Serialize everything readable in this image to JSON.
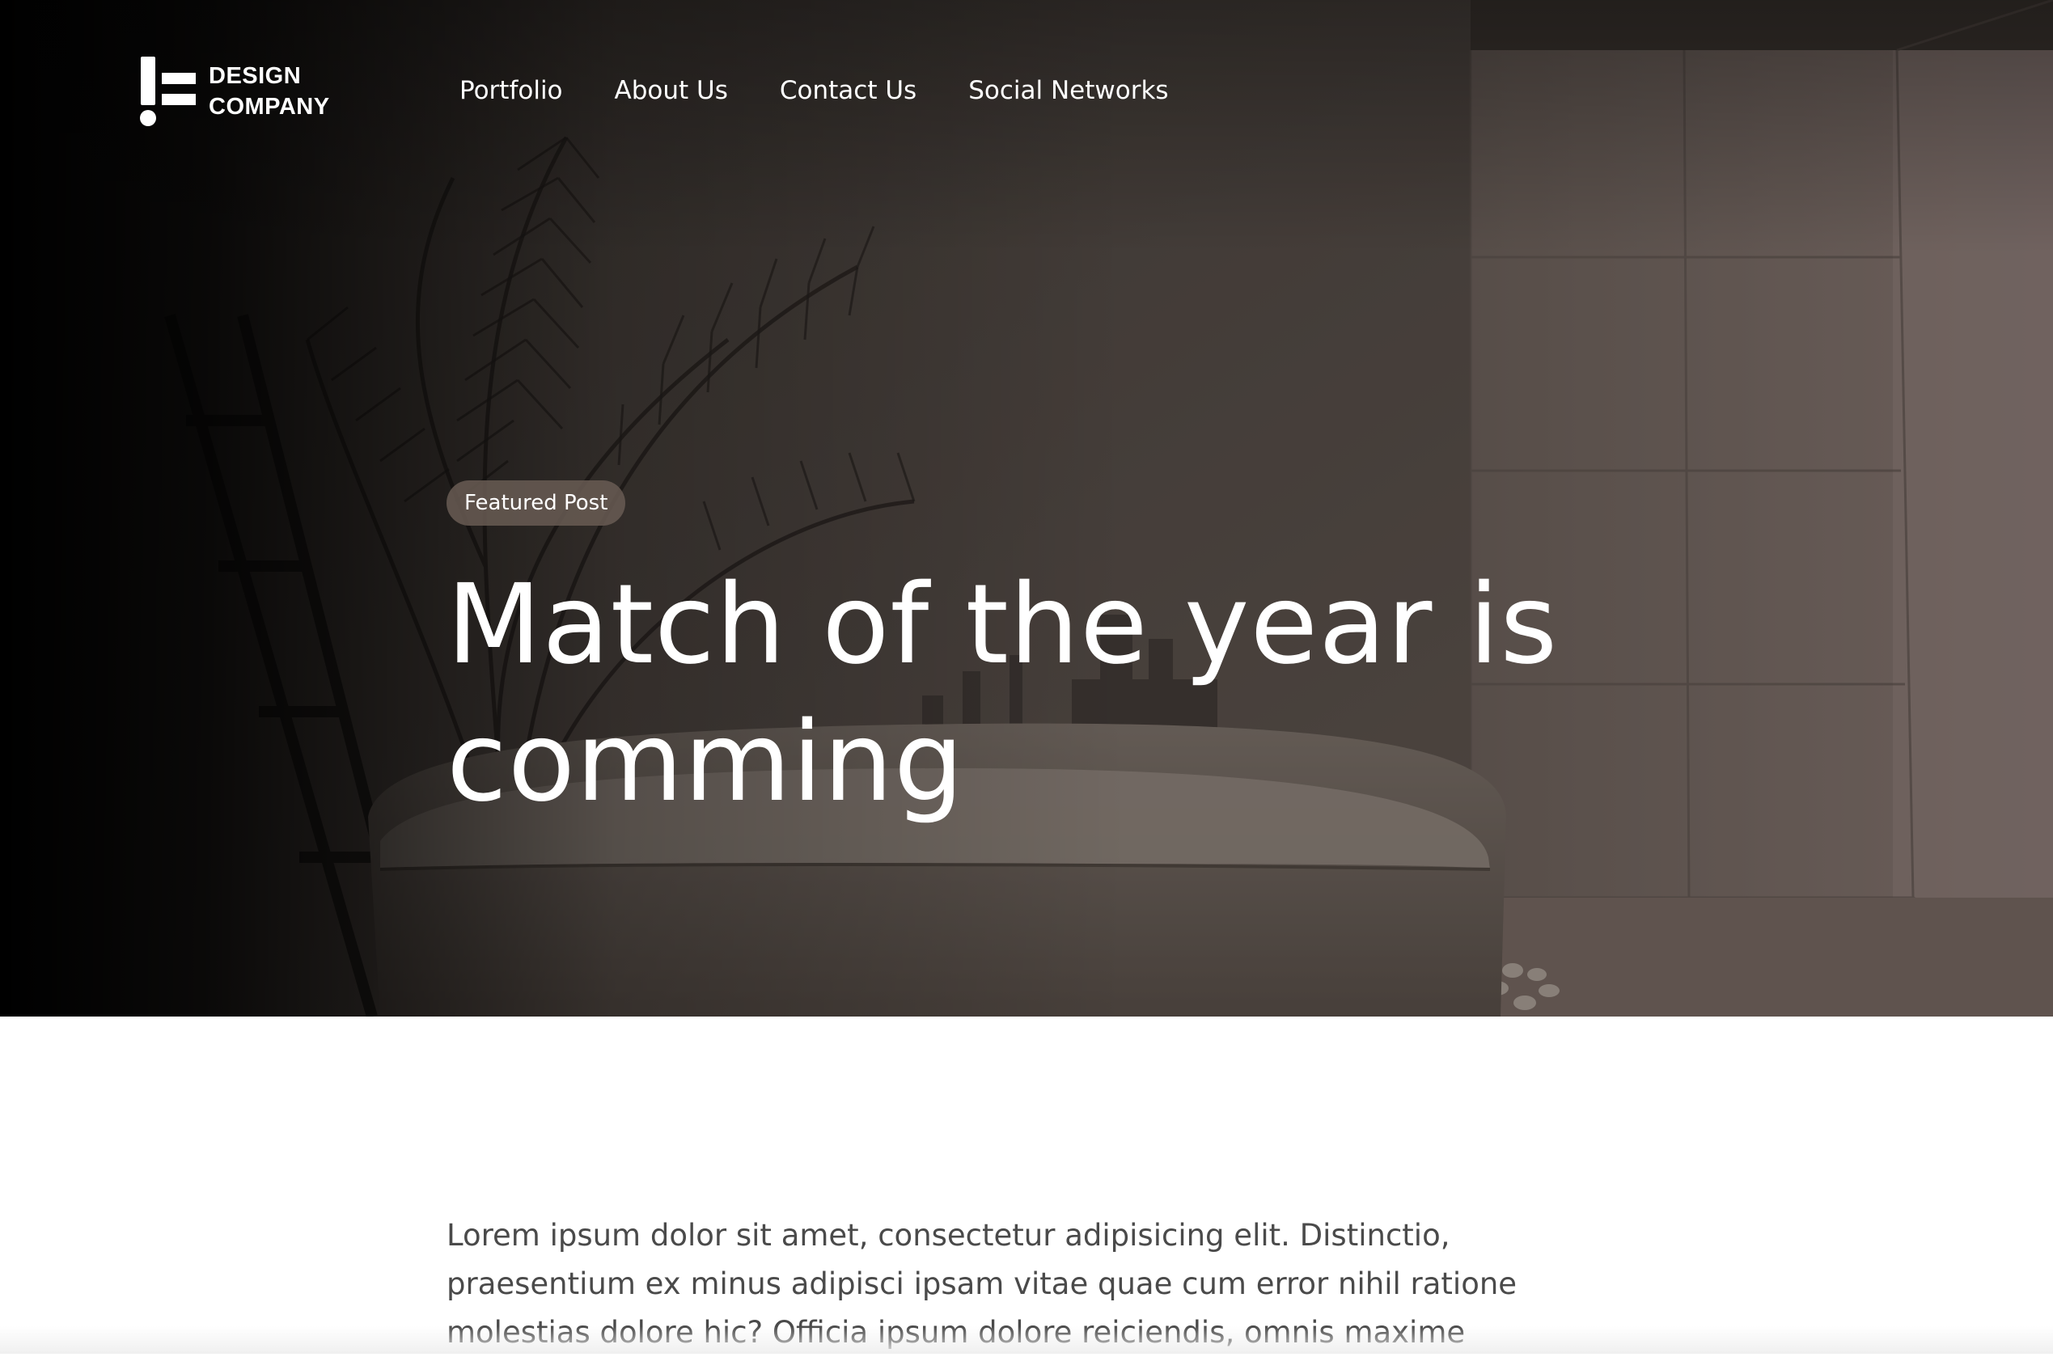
{
  "brand": {
    "line1": "DESIGN",
    "line2": "COMPANY",
    "logo_icon": "exclamation-equals-logo"
  },
  "nav": {
    "items": [
      {
        "label": "Portfolio"
      },
      {
        "label": "About Us"
      },
      {
        "label": "Contact Us"
      },
      {
        "label": "Social Networks"
      }
    ]
  },
  "hero": {
    "badge": "Featured Post",
    "title": "Match of the year is comming",
    "background_image": "dark bathroom with freestanding bathtub and palm plant",
    "overlay_color": "#2f2925"
  },
  "article": {
    "body": "Lorem ipsum dolor sit amet, consectetur adipisicing elit. Distinctio, praesentium ex minus adipisci ipsam vitae quae cum error nihil ratione molestias dolore hic? Officia ipsum dolore reiciendis, omnis maxime"
  },
  "colors": {
    "text_white": "#ffffff",
    "body_text": "#4a4a4a",
    "page_bg": "#ffffff"
  }
}
